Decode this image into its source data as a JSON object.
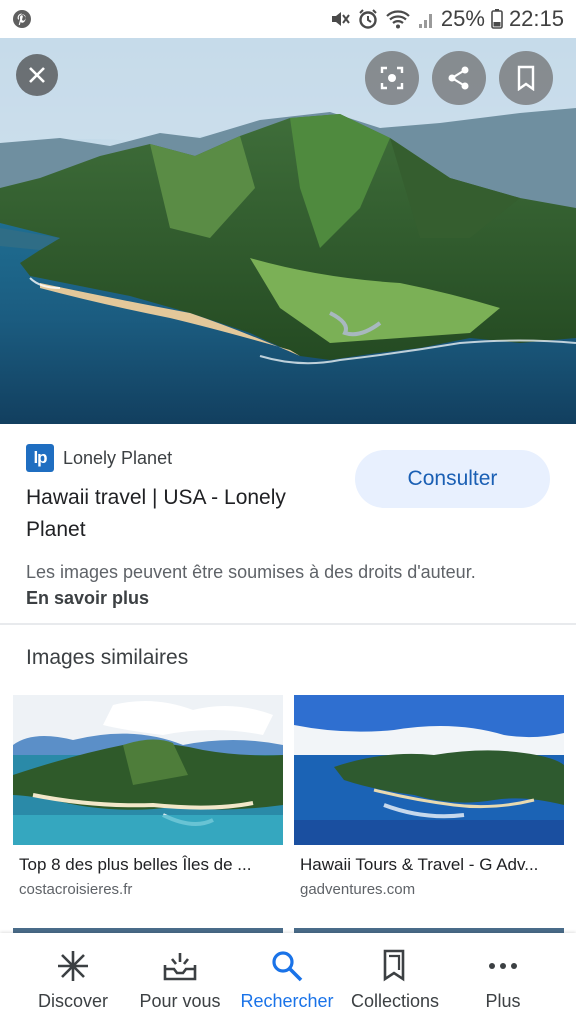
{
  "status_bar": {
    "battery": "25%",
    "time": "22:15",
    "icons": [
      "pinterest-icon",
      "mute-icon",
      "alarm-icon",
      "wifi-icon",
      "signal-icon",
      "battery-icon"
    ]
  },
  "hero": {
    "buttons": [
      "close-icon",
      "lens-icon",
      "share-icon",
      "bookmark-icon"
    ]
  },
  "source": {
    "logo_text": "lp",
    "name": "Lonely Planet",
    "title": "Hawaii travel | USA - Lonely Planet",
    "visit_label": "Consulter",
    "copyright": "Les images peuvent être soumises à des droits d'auteur.",
    "learn_more": "En savoir plus"
  },
  "similar": {
    "heading": "Images similaires",
    "items": [
      {
        "title": "Top 8 des plus belles Îles de ...",
        "site": "costacroisieres.fr"
      },
      {
        "title": "Hawaii Tours & Travel - G Adv...",
        "site": "gadventures.com"
      }
    ]
  },
  "bottom_nav": {
    "items": [
      {
        "label": "Discover",
        "icon": "asterisk-icon"
      },
      {
        "label": "Pour vous",
        "icon": "inbox-icon"
      },
      {
        "label": "Rechercher",
        "icon": "search-icon"
      },
      {
        "label": "Collections",
        "icon": "collections-icon"
      },
      {
        "label": "Plus",
        "icon": "more-icon"
      }
    ],
    "active_color": "#1a73e8"
  }
}
